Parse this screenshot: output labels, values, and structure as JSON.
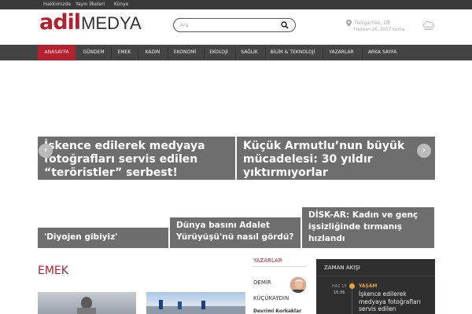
{
  "topbar": {
    "links": [
      "Hakkımızda",
      "Yayın İlkeleri",
      "Künye"
    ]
  },
  "logo": {
    "part1": "adil",
    "part2": "MEDYA"
  },
  "search": {
    "placeholder": "Ara"
  },
  "weather": {
    "location": "Tiergarten, DE",
    "date": "Haziran 16, 2017 cuma"
  },
  "nav": {
    "items": [
      "ANASAYFA",
      "GÜNDEM",
      "EMEK",
      "KADIN",
      "EKONOMİ",
      "EKOLOJİ",
      "SAĞLIK",
      "BİLİM & TEKNOLOJİ",
      "YAZARLAR",
      "ARKA SAYFA"
    ]
  },
  "slider": {
    "captions": [
      "İşkence edilerek medyaya fotoğrafları servis edilen “teröristler” serbest!",
      "Küçük Armutlu’nun büyük mücadelesi: 30 yıldır yıktırmıyorlar"
    ],
    "prev": "‹",
    "next": "›"
  },
  "cards": [
    "'Diyojen gibiyiz'",
    "Dünya basını Adalet Yürüyüşü'nü nasıl gördü?",
    "DİSK-AR: Kadın ve genç işsizliğinde tırmanış hızlandı"
  ],
  "section": {
    "title": "EMEK"
  },
  "authors": {
    "title": "YAZARLAR",
    "first_name": "DEMİR",
    "last_name": "KÜÇÜKAYDIN",
    "article": "Devrimi Korkaklar"
  },
  "timeline": {
    "title": "ZAMAN AKIŞI",
    "month": "HAZ 15",
    "time": "16:36",
    "category": "YAŞAM",
    "text": "İşkence edilerek medyaya fotoğrafları servis edilen \"teröristler\" serbest!"
  },
  "colors": {
    "accent": "#b5202e",
    "nav_bg": "#444444",
    "timeline_bg": "#2f2f2f",
    "timeline_accent": "#e0a43a"
  }
}
